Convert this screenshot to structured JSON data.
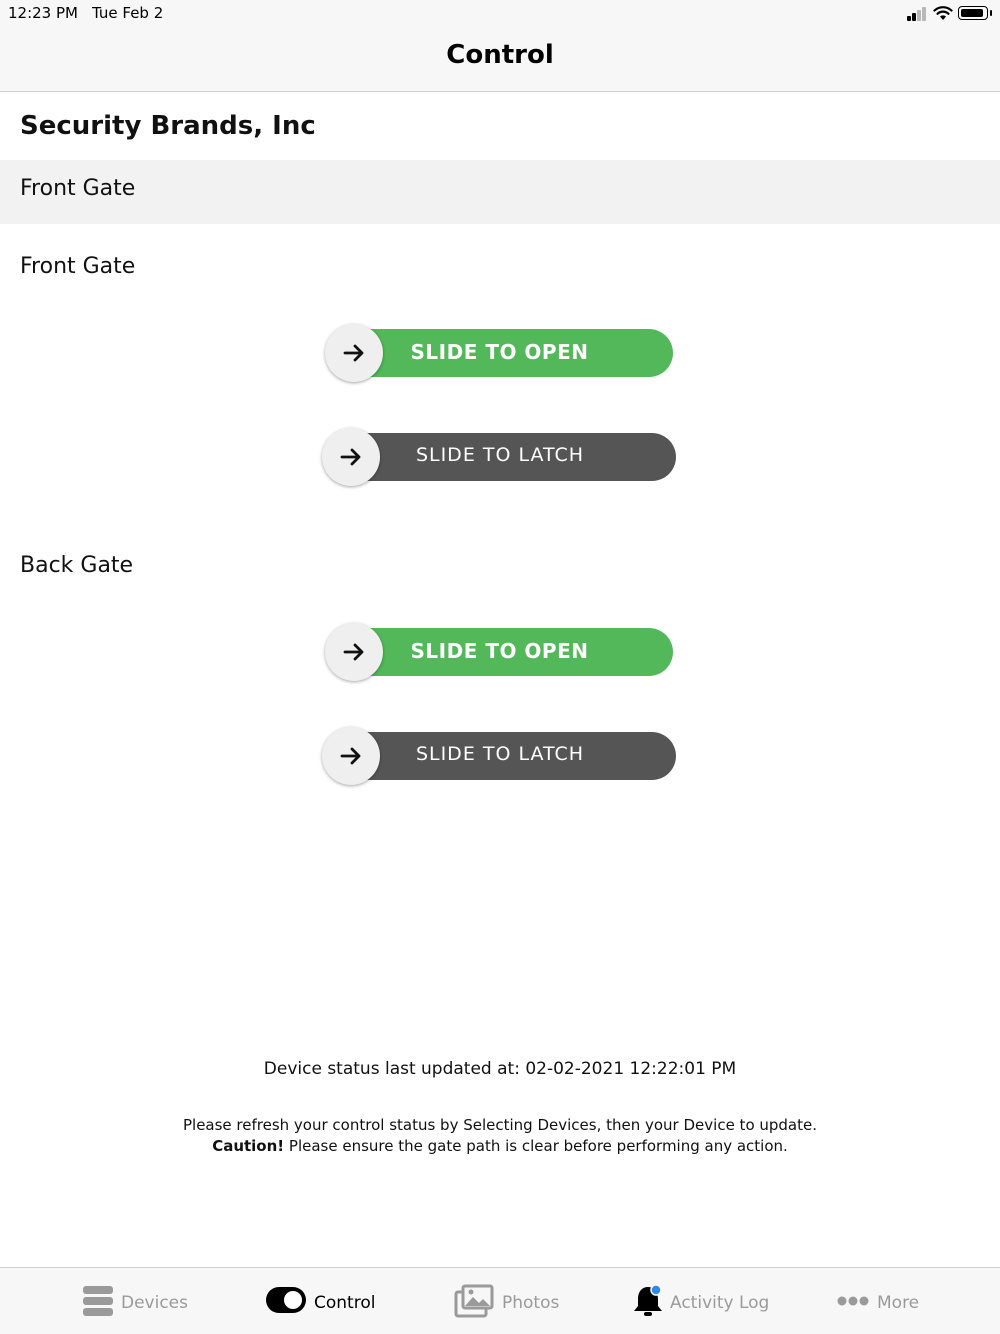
{
  "status_bar": {
    "time": "12:23 PM",
    "date": "Tue Feb 2"
  },
  "header": {
    "title": "Control"
  },
  "company": {
    "name": "Security Brands, Inc"
  },
  "group": {
    "name": "Front Gate"
  },
  "gates": [
    {
      "name": "Front Gate",
      "open_label": "SLIDE TO OPEN",
      "latch_label": "SLIDE TO LATCH"
    },
    {
      "name": "Back Gate",
      "open_label": "SLIDE TO OPEN",
      "latch_label": "SLIDE TO LATCH"
    }
  ],
  "status": {
    "last_updated": "Device status last updated at: 02-02-2021 12:22:01 PM",
    "refresh_note": "Please refresh your control status by Selecting Devices, then your Device to update.",
    "caution_label": "Caution!",
    "caution_text": "Please ensure the gate path is clear before performing any action."
  },
  "tabs": [
    {
      "label": "Devices",
      "icon": "devices-icon"
    },
    {
      "label": "Control",
      "icon": "toggle-icon",
      "active": true
    },
    {
      "label": "Photos",
      "icon": "photos-icon"
    },
    {
      "label": "Activity Log",
      "icon": "bell-icon"
    },
    {
      "label": "More",
      "icon": "more-icon"
    }
  ],
  "colors": {
    "open": "#52b85a",
    "latch": "#555555",
    "badge": "#2d8ae6"
  }
}
